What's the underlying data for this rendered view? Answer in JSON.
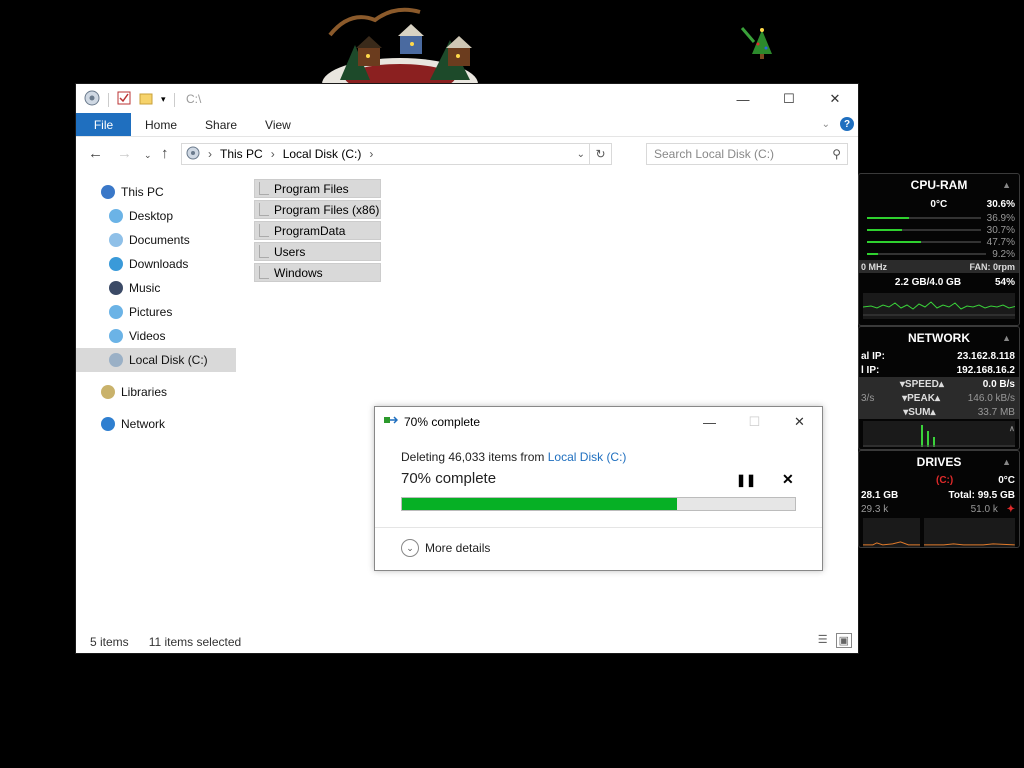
{
  "explorer": {
    "title_path": "C:\\",
    "ribbon_tabs": [
      "File",
      "Home",
      "Share",
      "View"
    ],
    "breadcrumb": [
      "This PC",
      "Local Disk (C:)"
    ],
    "search_placeholder": "Search Local Disk (C:)",
    "nav": [
      {
        "label": "This PC",
        "icon": "pc-icon",
        "indent": 0
      },
      {
        "label": "Desktop",
        "icon": "desktop-icon",
        "indent": 1
      },
      {
        "label": "Documents",
        "icon": "documents-icon",
        "indent": 1
      },
      {
        "label": "Downloads",
        "icon": "downloads-icon",
        "indent": 1
      },
      {
        "label": "Music",
        "icon": "music-icon",
        "indent": 1
      },
      {
        "label": "Pictures",
        "icon": "pictures-icon",
        "indent": 1
      },
      {
        "label": "Videos",
        "icon": "videos-icon",
        "indent": 1
      },
      {
        "label": "Local Disk (C:)",
        "icon": "disk-icon",
        "indent": 1,
        "selected": true
      },
      {
        "label": "Libraries",
        "icon": "libraries-icon",
        "indent": 0
      },
      {
        "label": "Network",
        "icon": "network-icon",
        "indent": 0
      }
    ],
    "files": [
      "Program Files",
      "Program Files (x86)",
      "ProgramData",
      "Users",
      "Windows"
    ],
    "status": {
      "items": "5 items",
      "selected": "11 items selected"
    }
  },
  "dialog": {
    "title": "70% complete",
    "line_prefix": "Deleting 46,033 items from",
    "line_link": "Local Disk (C:)",
    "big": "70% complete",
    "progress": 0.7,
    "more": "More details",
    "progress_color": "#06b025"
  },
  "gadgets": {
    "cpu": {
      "title": "CPU-RAM",
      "temp": "0°C",
      "total": "30.6%",
      "cores": [
        {
          "value": "36.9%",
          "level": 0.369
        },
        {
          "value": "30.7%",
          "level": 0.307
        },
        {
          "value": "47.7%",
          "level": 0.477
        },
        {
          "value": "9.2%",
          "level": 0.092
        }
      ],
      "mhz": "0 MHz",
      "fan": "FAN: 0rpm",
      "ram": "2.2 GB/4.0 GB",
      "ram_pct": "54%"
    },
    "network": {
      "title": "NETWORK",
      "ip1_label": "al IP:",
      "ip1": "23.162.8.118",
      "ip2_label": "l IP:",
      "ip2": "192.168.16.2",
      "speed_label": "SPEED",
      "speed": "0.0 B/s",
      "peak_left": "3/s",
      "peak_label": "PEAK",
      "peak": "146.0 kB/s",
      "sum_label": "SUM",
      "sum": "33.7 MB"
    },
    "drives": {
      "title": "DRIVES",
      "drive": "(C:)",
      "temp": "0°C",
      "used": "28.1 GB",
      "total": "Total: 99.5 GB",
      "read": "29.3 k",
      "write": "51.0 k"
    }
  }
}
